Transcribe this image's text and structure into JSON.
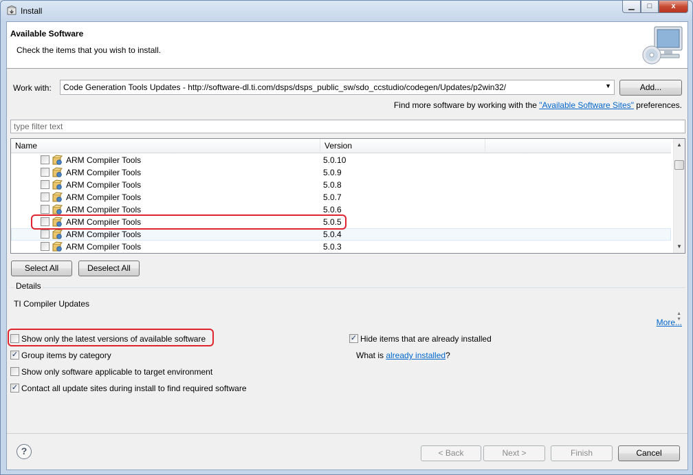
{
  "window": {
    "title": "Install",
    "buttons": {
      "minimize": "▁",
      "maximize": "□",
      "close": "x"
    }
  },
  "banner": {
    "title": "Available Software",
    "subtitle": "Check the items that you wish to install."
  },
  "work_with": {
    "label": "Work with:",
    "value": "Code Generation Tools Updates - http://software-dl.ti.com/dsps/dsps_public_sw/sdo_ccstudio/codegen/Updates/p2win32/",
    "add_button": "Add...",
    "find_more_prefix": "Find more software by working with the ",
    "find_more_link": "\"Available Software Sites\"",
    "find_more_suffix": " preferences."
  },
  "filter": {
    "placeholder": "type filter text"
  },
  "table": {
    "columns": [
      "Name",
      "Version"
    ],
    "rows": [
      {
        "name": "ARM Compiler Tools",
        "version": "5.0.10",
        "checked": false
      },
      {
        "name": "ARM Compiler Tools",
        "version": "5.0.9",
        "checked": false
      },
      {
        "name": "ARM Compiler Tools",
        "version": "5.0.8",
        "checked": false
      },
      {
        "name": "ARM Compiler Tools",
        "version": "5.0.7",
        "checked": false
      },
      {
        "name": "ARM Compiler Tools",
        "version": "5.0.6",
        "checked": false
      },
      {
        "name": "ARM Compiler Tools",
        "version": "5.0.5",
        "checked": false,
        "highlighted": true
      },
      {
        "name": "ARM Compiler Tools",
        "version": "5.0.4",
        "checked": false,
        "hovered": true
      },
      {
        "name": "ARM Compiler Tools",
        "version": "5.0.3",
        "checked": false
      }
    ]
  },
  "selection_buttons": {
    "select_all": "Select All",
    "deselect_all": "Deselect All"
  },
  "details": {
    "title": "Details",
    "text": "TI Compiler Updates",
    "more_link": "More..."
  },
  "options": {
    "latest_only": {
      "label": "Show only the latest versions of available software",
      "checked": false
    },
    "group_by_category": {
      "label": "Group items by category",
      "checked": true
    },
    "target_env": {
      "label": "Show only software applicable to target environment",
      "checked": false
    },
    "contact_sites": {
      "label": "Contact all update sites during install to find required software",
      "checked": true
    },
    "hide_installed": {
      "label": "Hide items that are already installed",
      "checked": true
    },
    "what_is_prefix": "What is ",
    "what_is_link": "already installed",
    "what_is_suffix": "?"
  },
  "footer": {
    "help": "?",
    "back": "< Back",
    "next": "Next >",
    "finish": "Finish",
    "cancel": "Cancel"
  },
  "colors": {
    "highlight": "#e0242e",
    "link": "#0066cc"
  }
}
